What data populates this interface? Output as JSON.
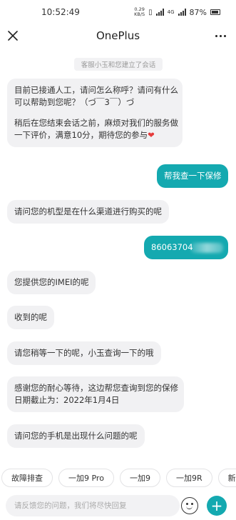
{
  "status_bar": {
    "time": "10:52:49",
    "net_speed_value": "0.29",
    "net_speed_unit": "KB/S",
    "network_label": "4G",
    "battery": "87%"
  },
  "header": {
    "title": "OnePlus",
    "close_icon": "close-icon",
    "more_icon": "more-icon"
  },
  "chat": {
    "system_note": "客服小玉和您建立了会话",
    "messages": [
      {
        "from": "agent",
        "lines": [
          "目前已接通人工，请问怎么称呼？请问有什么",
          "可以帮助到您呢？（づ￣3￣）づ",
          "",
          "稍后在您结束会话之前，麻烦对我们的服务做",
          "一下评价，满意10分，期待您的参与❤️"
        ]
      },
      {
        "from": "user",
        "text": "帮我查一下保修"
      },
      {
        "from": "agent",
        "text": "请问您的机型是在什么渠道进行购买的呢"
      },
      {
        "from": "user",
        "text": "86063704"
      },
      {
        "from": "agent",
        "text": "您提供您的IMEI的呢"
      },
      {
        "from": "agent",
        "text": "收到的呢"
      },
      {
        "from": "agent",
        "text": "请您稍等一下的呢，小玉查询一下的哦"
      },
      {
        "from": "agent",
        "lines": [
          "感谢您的耐心等待，这边帮您查询到您的保修",
          "日期截止为：2022年1月4日"
        ]
      },
      {
        "from": "agent",
        "text": "请问您的手机是出现什么问题的呢"
      }
    ]
  },
  "quick_replies": [
    "故障排查",
    "一加9 Pro",
    "一加9",
    "一加9R",
    "新品"
  ],
  "input": {
    "placeholder": "请反馈您的问题，我们将尽快回复",
    "emoji_icon": "emoji-icon",
    "plus_icon": "plus-icon"
  },
  "colors": {
    "accent": "#14a9b0",
    "agent_bubble": "#f1f1f3",
    "heart": "#e53b3b"
  }
}
